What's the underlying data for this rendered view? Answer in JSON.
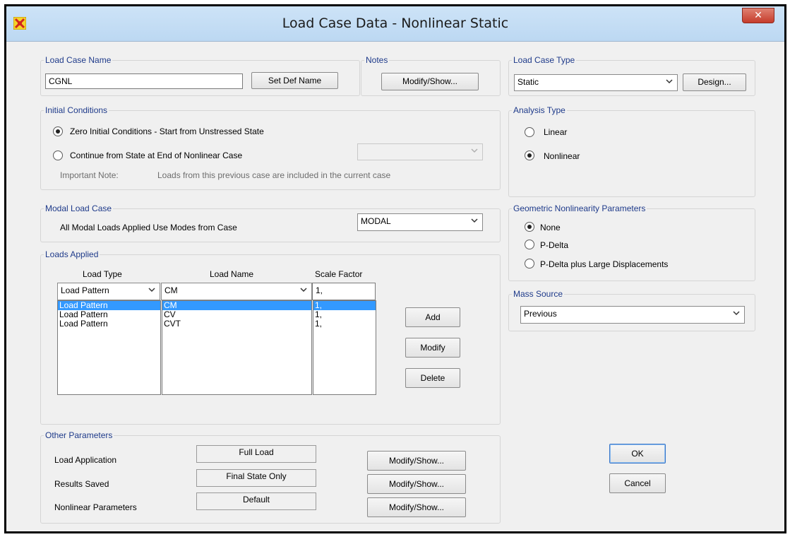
{
  "window": {
    "title": "Load Case Data - Nonlinear Static",
    "close_label": "✕"
  },
  "load_case_name": {
    "legend": "Load Case Name",
    "value": "CGNL",
    "set_def_label": "Set Def Name"
  },
  "notes": {
    "legend": "Notes",
    "button_label": "Modify/Show..."
  },
  "load_case_type": {
    "legend": "Load Case Type",
    "value": "Static",
    "design_label": "Design..."
  },
  "initial_conditions": {
    "legend": "Initial Conditions",
    "option_zero": "Zero Initial Conditions - Start from Unstressed State",
    "option_continue": "Continue from State at End of Nonlinear Case",
    "continue_case_value": "",
    "note_label": "Important Note:",
    "note_text": "Loads from this previous case are included in the current case",
    "selected": "zero"
  },
  "analysis_type": {
    "legend": "Analysis Type",
    "linear": "Linear",
    "nonlinear": "Nonlinear",
    "selected": "nonlinear"
  },
  "modal_load_case": {
    "legend": "Modal Load Case",
    "label": "All Modal Loads Applied Use Modes from Case",
    "value": "MODAL"
  },
  "geometric_nonlinearity": {
    "legend": "Geometric Nonlinearity Parameters",
    "none": "None",
    "p_delta": "P-Delta",
    "p_delta_large": "P-Delta plus Large Displacements",
    "selected": "none"
  },
  "loads_applied": {
    "legend": "Loads Applied",
    "headers": {
      "load_type": "Load Type",
      "load_name": "Load Name",
      "scale_factor": "Scale Factor"
    },
    "edit_row": {
      "load_type": "Load Pattern",
      "load_name": "CM",
      "scale_factor": "1,"
    },
    "rows": [
      {
        "load_type": "Load Pattern",
        "load_name": "CM",
        "scale_factor": "1,",
        "selected": true
      },
      {
        "load_type": "Load Pattern",
        "load_name": "CV",
        "scale_factor": "1,",
        "selected": false
      },
      {
        "load_type": "Load Pattern",
        "load_name": "CVT",
        "scale_factor": "1,",
        "selected": false
      }
    ],
    "add_label": "Add",
    "modify_label": "Modify",
    "delete_label": "Delete"
  },
  "mass_source": {
    "legend": "Mass Source",
    "value": "Previous"
  },
  "other_parameters": {
    "legend": "Other Parameters",
    "rows": [
      {
        "label": "Load Application",
        "value": "Full Load",
        "button": "Modify/Show..."
      },
      {
        "label": "Results Saved",
        "value": "Final State Only",
        "button": "Modify/Show..."
      },
      {
        "label": "Nonlinear Parameters",
        "value": "Default",
        "button": "Modify/Show..."
      }
    ]
  },
  "dialog_buttons": {
    "ok": "OK",
    "cancel": "Cancel"
  },
  "colors": {
    "legend": "#1e3a8a",
    "selection": "#3399ff",
    "titlebar": "#cde3f7",
    "close": "#c53c2b"
  },
  "icons": {
    "app": "sap2000-app-icon",
    "close": "close-icon",
    "dropdown": "chevron-down-icon"
  }
}
